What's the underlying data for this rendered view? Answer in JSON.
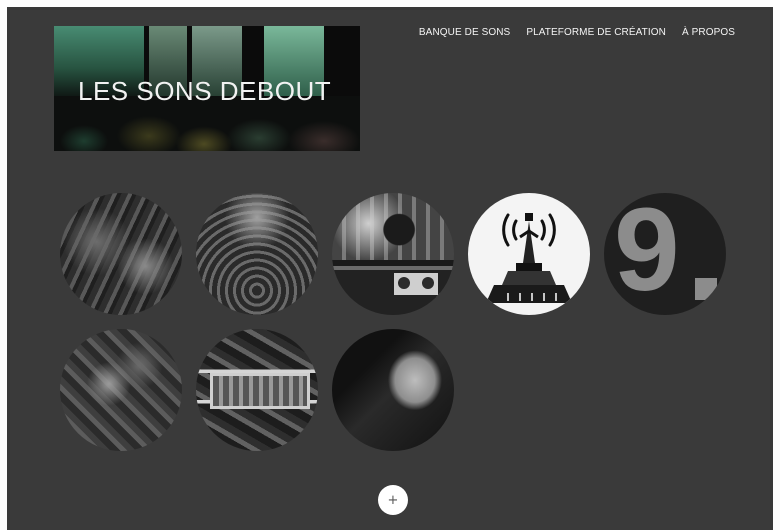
{
  "site": {
    "title": "LES SONS DEBOUT"
  },
  "nav": {
    "items": [
      {
        "label": "BANQUE DE SONS"
      },
      {
        "label": "PLATEFORME DE CRÉATION"
      },
      {
        "label": "À PROPOS"
      }
    ]
  },
  "gallery": {
    "items": [
      {
        "icon": "crowd-photo"
      },
      {
        "icon": "crowd-square-photo"
      },
      {
        "icon": "musicians-boombox-photo"
      },
      {
        "icon": "radio-tower-statue-illustration"
      },
      {
        "icon": "number-nine-graphic",
        "text": "9"
      },
      {
        "icon": "crowd-abstract-photo"
      },
      {
        "icon": "collage-rectangle-graphic"
      },
      {
        "icon": "singing-face-photo"
      }
    ]
  },
  "load_more": {
    "label": "+"
  },
  "colors": {
    "page_background": "#3a3a3a",
    "nav_text": "#f4f4f4",
    "button_background": "#ffffff"
  }
}
